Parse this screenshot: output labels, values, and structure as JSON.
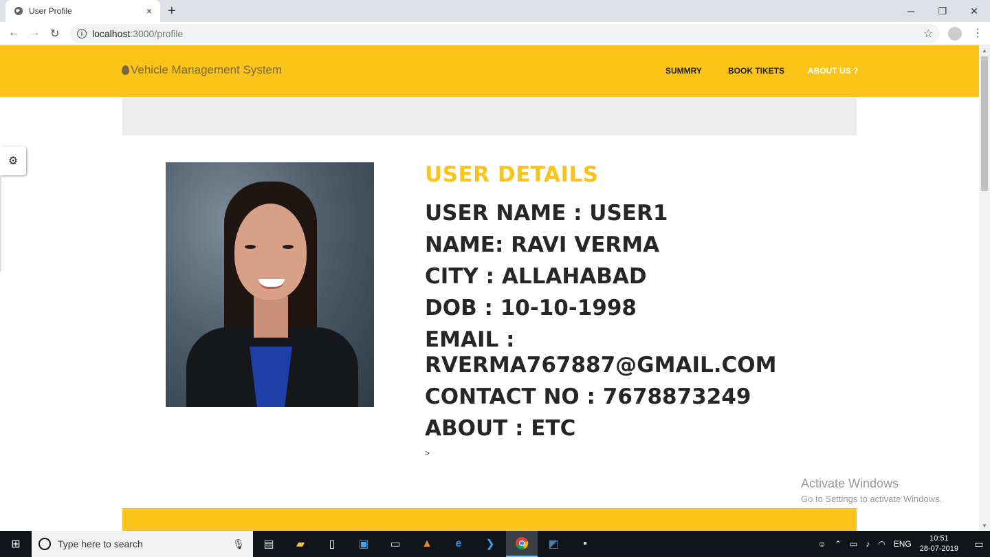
{
  "browser": {
    "tab_title": "User Profile",
    "tab_close": "×",
    "new_tab": "+",
    "url_host": "localhost",
    "url_path": ":3000/profile",
    "minimize": "─",
    "maximize": "❐",
    "close": "✕",
    "back": "←",
    "forward": "→",
    "reload": "↻",
    "info": "i",
    "star": "☆",
    "menu": "⋮"
  },
  "header": {
    "brand": "Vehicle Management System",
    "nav": [
      "SUMMRY",
      "BOOK TIKETS",
      "ABOUT US ?"
    ]
  },
  "settings_icon": "⚙",
  "profile": {
    "heading": "USER DETAILS",
    "lines": [
      "USER NAME : USER1",
      "NAME: RAVI VERMA",
      "CITY : ALLAHABAD",
      "DOB : 10-10-1998",
      "EMAIL : RVERMA767887@GMAIL.COM",
      "CONTACT NO : 7678873249",
      "ABOUT : ETC"
    ],
    "trailing": ">"
  },
  "watermark": {
    "line1": "Activate Windows",
    "line2": "Go to Settings to activate Windows."
  },
  "taskbar": {
    "start": "⊞",
    "search_placeholder": "Type here to search",
    "mic": "🎤",
    "icons": [
      "task-view-icon",
      "file-explorer-icon",
      "notepad-icon",
      "windows-app-icon",
      "terminal-icon",
      "vlc-icon",
      "edge-icon",
      "vscode-icon",
      "chrome-icon",
      "mysql-workbench-icon",
      "mysql-cli-icon"
    ],
    "lang": "ENG",
    "time": "10:51",
    "date": "28-07-2019"
  }
}
